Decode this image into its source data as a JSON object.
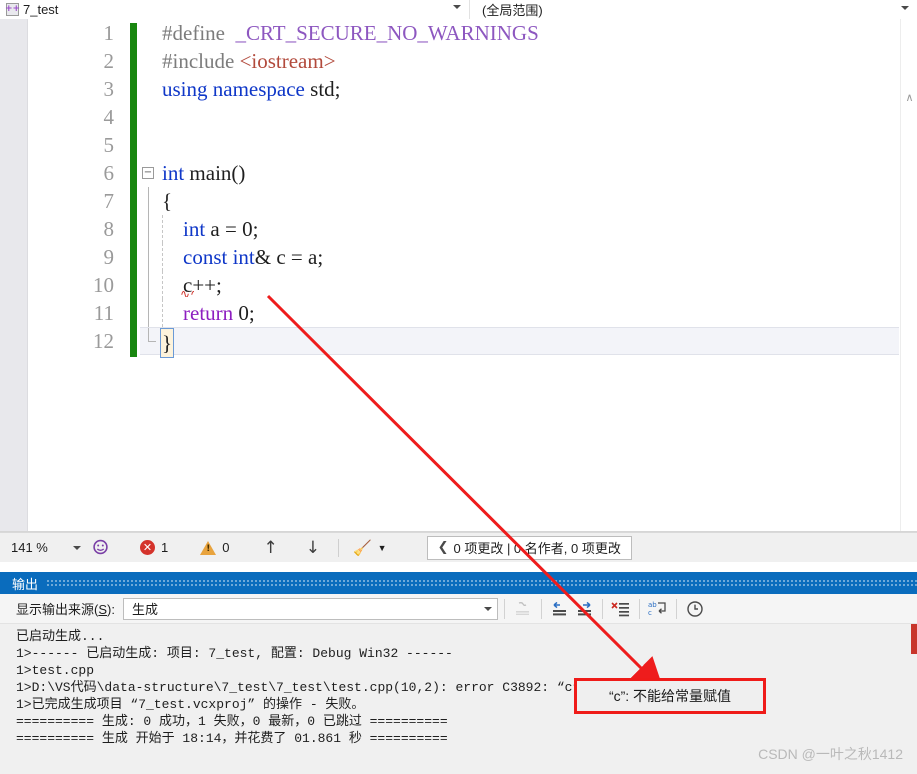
{
  "tab": {
    "title": "7_test",
    "icon": "cpp-file-icon",
    "glyph": "++",
    "dropdown_icon": "chevron-down-icon"
  },
  "scope_bar": {
    "value": "(全局范围)",
    "dropdown_icon": "chevron-down-icon"
  },
  "editor": {
    "line_numbers": [
      "1",
      "2",
      "3",
      "4",
      "5",
      "6",
      "7",
      "8",
      "9",
      "10",
      "11",
      "12"
    ],
    "lines": [
      {
        "n": 1,
        "tokens": [
          {
            "t": "#define",
            "c": "k-pre"
          },
          {
            "t": "  ",
            "c": "k-id"
          },
          {
            "t": "_CRT_SECURE_NO_WARNINGS",
            "c": "k-macro"
          }
        ]
      },
      {
        "n": 2,
        "tokens": [
          {
            "t": "#include",
            "c": "k-pre"
          },
          {
            "t": " ",
            "c": "k-id"
          },
          {
            "t": "<iostream>",
            "c": "k-str"
          }
        ]
      },
      {
        "n": 3,
        "tokens": [
          {
            "t": "using",
            "c": "k-kw"
          },
          {
            "t": " ",
            "c": "k-id"
          },
          {
            "t": "namespace",
            "c": "k-kw"
          },
          {
            "t": " std;",
            "c": "k-id"
          }
        ]
      },
      {
        "n": 4,
        "tokens": []
      },
      {
        "n": 5,
        "tokens": []
      },
      {
        "n": 6,
        "tokens": [
          {
            "t": "int",
            "c": "k-kw"
          },
          {
            "t": " main()",
            "c": "k-id"
          }
        ]
      },
      {
        "n": 7,
        "tokens": [
          {
            "t": "{",
            "c": "k-id"
          }
        ]
      },
      {
        "n": 8,
        "tokens": [
          {
            "t": "    ",
            "c": "k-id"
          },
          {
            "t": "int",
            "c": "k-kw"
          },
          {
            "t": " a = ",
            "c": "k-id"
          },
          {
            "t": "0",
            "c": "k-num"
          },
          {
            "t": ";",
            "c": "k-id"
          }
        ]
      },
      {
        "n": 9,
        "tokens": [
          {
            "t": "    ",
            "c": "k-id"
          },
          {
            "t": "const",
            "c": "k-kw"
          },
          {
            "t": " ",
            "c": "k-id"
          },
          {
            "t": "int",
            "c": "k-kw"
          },
          {
            "t": "& c = a;",
            "c": "k-id"
          }
        ]
      },
      {
        "n": 10,
        "tokens": [
          {
            "t": "    c++;",
            "c": "k-id"
          }
        ]
      },
      {
        "n": 11,
        "tokens": [
          {
            "t": "    ",
            "c": "k-id"
          },
          {
            "t": "return",
            "c": "k-kw2"
          },
          {
            "t": " ",
            "c": "k-id"
          },
          {
            "t": "0",
            "c": "k-num"
          },
          {
            "t": ";",
            "c": "k-id"
          }
        ]
      },
      {
        "n": 12,
        "tokens": [
          {
            "t": "}",
            "c": "k-id"
          }
        ]
      }
    ],
    "fold_glyph": "−",
    "change_bar_color": "#18860f",
    "squiggle_line": 10,
    "current_line": 12
  },
  "status_bar": {
    "zoom": "141 %",
    "zoom_dropdown_icon": "chevron-down-icon",
    "feedback_icon": "feedback-smiley-icon",
    "error_icon": "error-circle-icon",
    "error_count": "1",
    "warning_icon": "warning-triangle-icon",
    "warning_count": "0",
    "prev_icon": "arrow-up-icon",
    "next_icon": "arrow-down-icon",
    "cleanup_icon": "broom-icon",
    "cleanup_dropdown_icon": "chevron-down-icon",
    "source_control": {
      "chevron_icon": "chevron-left-icon",
      "text": "0 项更改 | 0 名作者, 0 项更改"
    }
  },
  "output_pane": {
    "title": "输出",
    "source_label_prefix": "显示输出来源(",
    "source_label_key": "S",
    "source_label_suffix": "):",
    "source_value": "生成",
    "source_dropdown_icon": "chevron-down-icon",
    "toolbar_icons": [
      "find-message-source-icon",
      "go-to-previous-message-icon",
      "go-to-next-message-icon",
      "clear-all-icon",
      "toggle-word-wrap-icon",
      "show-timestamps-icon"
    ],
    "lines": [
      "已启动生成...",
      "1>------ 已启动生成: 项目: 7_test, 配置: Debug Win32 ------",
      "1>test.cpp",
      "1>D:\\VS代码\\data-structure\\7_test\\7_test\\test.cpp(10,2): error C3892: “c”: 不能给常量赋值",
      "1>已完成生成项目 “7_test.vcxproj” 的操作 - 失败。",
      "========== 生成: 0 成功，1 失败，0 最新，0 已跳过 ==========",
      "========== 生成 开始于 18:14，并花费了 01.861 秒 =========="
    ]
  },
  "annotation": {
    "error_box_text": "“c”: 不能给常量赋值",
    "error_box_color": "#ef1b19",
    "arrow_color": "#ee1c1c"
  },
  "watermark": "CSDN @一叶之秋1412"
}
